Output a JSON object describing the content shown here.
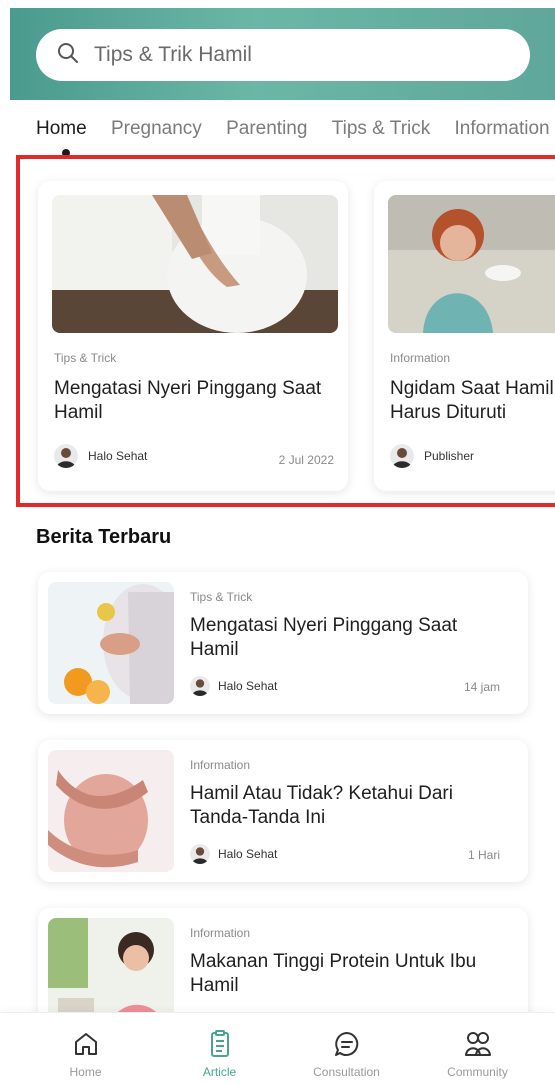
{
  "search": {
    "placeholder": "Tips & Trik Hamil"
  },
  "tabs": [
    {
      "label": "Home",
      "active": true
    },
    {
      "label": "Pregnancy"
    },
    {
      "label": "Parenting"
    },
    {
      "label": "Tips & Trick"
    },
    {
      "label": "Information"
    }
  ],
  "featured": [
    {
      "category": "Tips & Trick",
      "title": "Mengatasi Nyeri Pinggang Saat Hamil",
      "author": "Halo Sehat",
      "date": "2 Jul 2022"
    },
    {
      "category": "Information",
      "title": "Ngidam Saat Hamil, Apakah Harus Dituruti",
      "author": "Publisher"
    }
  ],
  "news": {
    "heading": "Berita Terbaru",
    "items": [
      {
        "category": "Tips & Trick",
        "title": "Mengatasi Nyeri Pinggang Saat Hamil",
        "author": "Halo Sehat",
        "time": "14 jam"
      },
      {
        "category": "Information",
        "title": "Hamil Atau Tidak? Ketahui Dari Tanda-Tanda Ini",
        "author": "Halo Sehat",
        "time": "1 Hari"
      },
      {
        "category": "Information",
        "title": "Makanan Tinggi Protein Untuk Ibu Hamil"
      }
    ]
  },
  "bottom_nav": [
    {
      "label": "Home",
      "icon": "home-icon"
    },
    {
      "label": "Article",
      "icon": "article-icon",
      "active": true
    },
    {
      "label": "Consultation",
      "icon": "chat-icon"
    },
    {
      "label": "Community",
      "icon": "people-icon"
    }
  ],
  "colors": {
    "accent": "#4aa392",
    "highlight_border": "#e22a2a",
    "header_start": "#4a9b8e"
  }
}
